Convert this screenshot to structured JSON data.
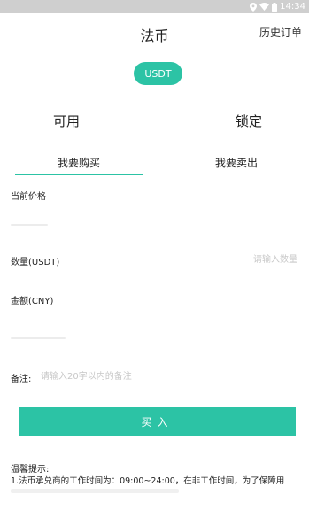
{
  "status_bar": {
    "time": "14:34"
  },
  "header": {
    "title": "法币",
    "history_label": "历史订单"
  },
  "currency_chip": {
    "label": "USDT"
  },
  "balances": {
    "available_label": "可用",
    "locked_label": "锁定"
  },
  "tabs": {
    "buy_label": "我要购买",
    "sell_label": "我要卖出",
    "active": "buy"
  },
  "form": {
    "price_label": "当前价格",
    "quantity_label": "数量(USDT)",
    "quantity_placeholder": "请输入数量",
    "amount_label": "金额(CNY)",
    "remark_label": "备注:",
    "remark_placeholder": "请输入20字以内的备注"
  },
  "buy_button": {
    "label": "买入"
  },
  "tips": {
    "title": "温馨提示:",
    "text": "1.法币承兑商的工作时间为：09:00~24:00，在非工作时间，为了保障用"
  },
  "colors": {
    "accent": "#2cc3a5",
    "status_bar": "#cfcfcf"
  }
}
